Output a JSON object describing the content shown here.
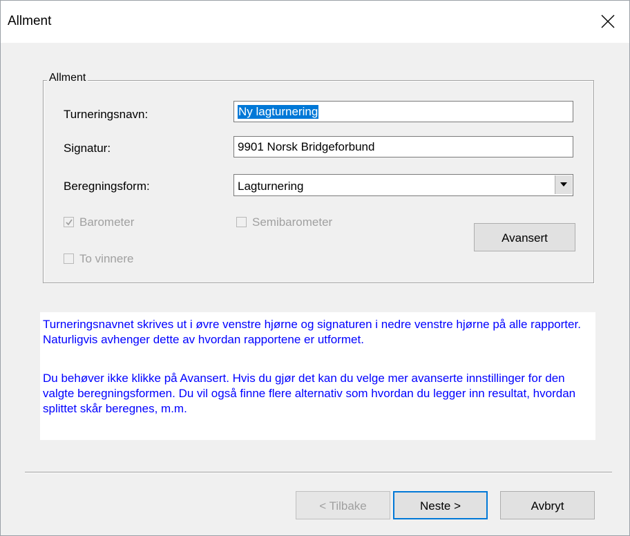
{
  "window": {
    "title": "Allment"
  },
  "group": {
    "legend": "Allment",
    "fields": {
      "turneringsnavn_label": "Turneringsnavn:",
      "turneringsnavn_value": "Ny lagturnering",
      "signatur_label": "Signatur:",
      "signatur_value": "9901 Norsk Bridgeforbund",
      "beregningsform_label": "Beregningsform:",
      "beregningsform_value": "Lagturnering"
    },
    "checkboxes": {
      "barometer_label": "Barometer",
      "barometer_checked": true,
      "semibarometer_label": "Semibarometer",
      "semibarometer_checked": false,
      "to_vinnere_label": "To vinnere",
      "to_vinnere_checked": false
    },
    "avansert_label": "Avansert"
  },
  "info": {
    "paragraph1": "Turneringsnavnet skrives ut i øvre venstre hjørne og signaturen i nedre venstre hjørne på alle rapporter. Naturligvis avhenger dette av hvordan rapportene er utformet.",
    "paragraph2": "Du behøver ikke klikke på Avansert. Hvis du gjør det kan du velge mer avanserte innstillinger for den valgte beregningsformen. Du vil også finne flere alternativ som hvordan du legger inn resultat, hvordan splittet skår beregnes, m.m."
  },
  "footer": {
    "back_label": "< Tilbake",
    "next_label": "Neste >",
    "cancel_label": "Avbryt"
  },
  "colors": {
    "info_text": "#0000ff",
    "selection": "#0078d7",
    "disabled_text": "#a0a0a0"
  },
  "icons": {
    "close": "close-icon",
    "dropdown": "chevron-down-icon",
    "check": "checkmark-icon"
  }
}
